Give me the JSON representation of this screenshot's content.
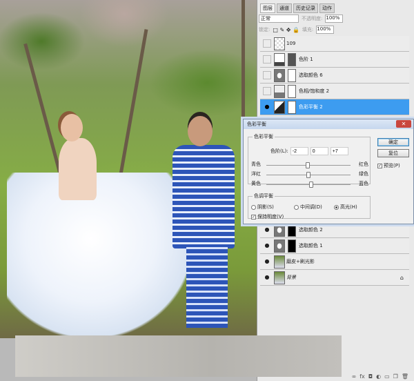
{
  "panel": {
    "tabs": [
      "图层",
      "通道",
      "历史记录",
      "动作"
    ],
    "blend_mode": "正常",
    "opacity_label": "不透明度:",
    "opacity": "100%",
    "lock_label": "锁定:",
    "fill_label": "填充:",
    "fill": "100%",
    "layers": [
      {
        "name": "109",
        "visible": false
      },
      {
        "name": "色阶 1",
        "visible": false
      },
      {
        "name": "选取颜色 6",
        "visible": false
      },
      {
        "name": "色相/饱和度 2",
        "visible": false
      },
      {
        "name": "色彩平衡 2",
        "visible": true,
        "selected": true
      },
      {
        "name": "选取颜色 2",
        "visible": true
      },
      {
        "name": "选取颜色 1",
        "visible": true
      },
      {
        "name": "磨皮+刷光影",
        "visible": true
      },
      {
        "name": "背景",
        "visible": true,
        "locked": true
      }
    ]
  },
  "dialog": {
    "title": "色彩平衡",
    "group1": "色彩平衡",
    "levels_label": "色阶(L):",
    "levels": [
      "-2",
      "0",
      "+7"
    ],
    "sliders": [
      {
        "left": "青色",
        "right": "红色",
        "value": -2
      },
      {
        "left": "洋红",
        "right": "绿色",
        "value": 0
      },
      {
        "left": "黄色",
        "right": "蓝色",
        "value": 7
      }
    ],
    "group2": "色调平衡",
    "tones": [
      "阴影(S)",
      "中间调(D)",
      "高光(H)"
    ],
    "selected_tone": 2,
    "preserve": "保持明度(V)",
    "ok": "确定",
    "reset": "复位",
    "preview": "预览(P)"
  }
}
